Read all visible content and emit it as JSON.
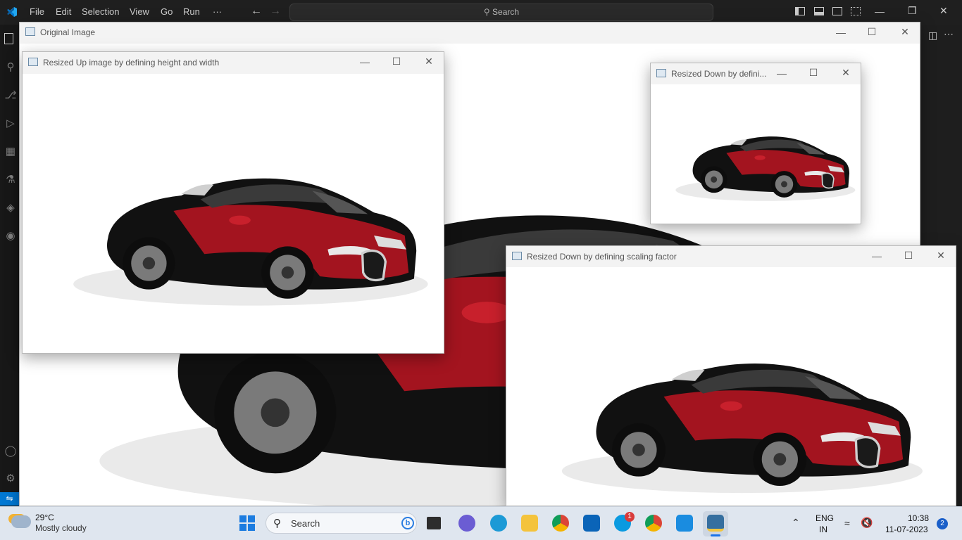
{
  "vscode": {
    "menu": [
      "File",
      "Edit",
      "Selection",
      "View",
      "Go",
      "Run",
      "···"
    ],
    "search_placeholder": "Search"
  },
  "windows": {
    "original": {
      "title": "Original Image"
    },
    "resized_up": {
      "title": "Resized Up image by defining height and width"
    },
    "resized_down_small": {
      "title": "Resized Down by defini..."
    },
    "resized_down_scale": {
      "title": "Resized Down by defining scaling factor"
    }
  },
  "window_controls": {
    "minimize": "—",
    "maximize": "☐",
    "close": "✕"
  },
  "taskbar": {
    "weather": {
      "temp": "29°C",
      "desc": "Mostly cloudy"
    },
    "search_label": "Search",
    "skype_badge": "1",
    "lang_top": "ENG",
    "lang_bottom": "IN",
    "time": "10:38",
    "date": "11-07-2023",
    "notif_count": "2"
  },
  "colors": {
    "vscode_bg": "#1f1f1f",
    "accent": "#0078d4",
    "car_red": "#a3141f",
    "car_black": "#111111"
  }
}
